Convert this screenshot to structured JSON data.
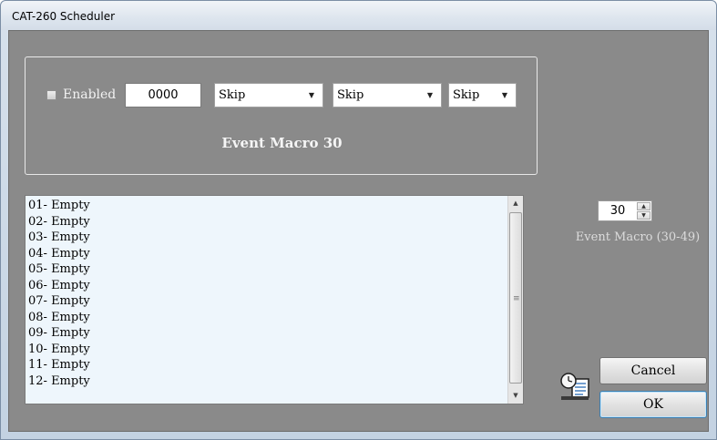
{
  "window": {
    "title": "CAT-260 Scheduler"
  },
  "event_group": {
    "enabled_label": "Enabled",
    "enabled_checked": false,
    "time_value": "0000",
    "selects": [
      "Skip",
      "Skip",
      "Skip"
    ],
    "title": "Event Macro 30"
  },
  "list": {
    "items": [
      "01- Empty",
      "02- Empty",
      "03- Empty",
      "04- Empty",
      "05- Empty",
      "06- Empty",
      "07- Empty",
      "08- Empty",
      "09- Empty",
      "10- Empty",
      "11- Empty",
      "12- Empty"
    ]
  },
  "spinner": {
    "value": "30",
    "label": "Event Macro (30-49)"
  },
  "buttons": {
    "cancel": "Cancel",
    "ok": "OK"
  },
  "icons": {
    "scheduler": "scheduler-clock-document-icon",
    "combo_arrow": "chevron-down-icon",
    "scroll_up": "scroll-up-arrow-icon",
    "scroll_down": "scroll-down-arrow-icon"
  }
}
